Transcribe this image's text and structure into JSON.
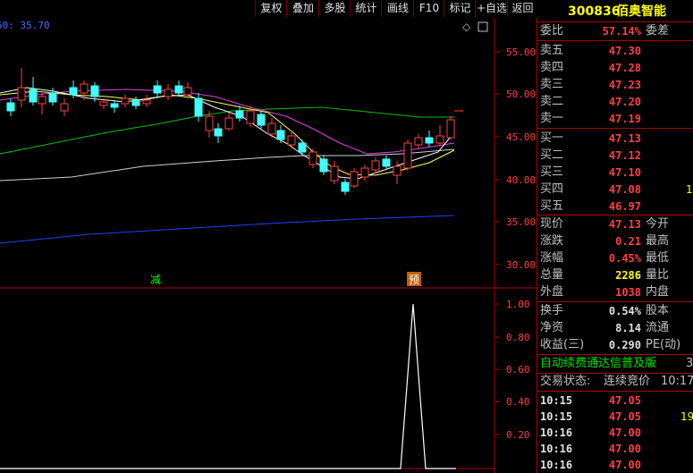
{
  "toolbar": {
    "buttons": [
      "复权",
      "叠加",
      "多股",
      "统计",
      "画线",
      "F10",
      "标记",
      "+自选",
      "返回"
    ]
  },
  "main_chart": {
    "ma_label": "50: 35.70",
    "y_ticks": [
      "55.00",
      "50.00",
      "45.00",
      "40.00",
      "35.00",
      "30.00"
    ],
    "marker_left": "减",
    "marker_right": "预",
    "diamond_icon": "◇"
  },
  "indicator": {
    "y_ticks": [
      "1.00",
      "0.80",
      "0.60",
      "0.40",
      "0.20"
    ]
  },
  "stock": {
    "code": "300836",
    "name": "佰奥智能"
  },
  "ratio": {
    "label": "委比",
    "value": "57.14%",
    "label2": "委差"
  },
  "asks": [
    {
      "label": "卖五",
      "price": "47.30"
    },
    {
      "label": "卖四",
      "price": "47.28"
    },
    {
      "label": "卖三",
      "price": "47.23"
    },
    {
      "label": "卖二",
      "price": "47.20"
    },
    {
      "label": "卖一",
      "price": "47.19"
    }
  ],
  "bids": [
    {
      "label": "买一",
      "price": "47.13"
    },
    {
      "label": "买二",
      "price": "47.12"
    },
    {
      "label": "买三",
      "price": "47.10"
    },
    {
      "label": "买四",
      "price": "47.08",
      "extra": "1"
    },
    {
      "label": "买五",
      "price": "46.97"
    }
  ],
  "quote": [
    {
      "label": "现价",
      "value": "47.13",
      "label2": "今开",
      "color": "red"
    },
    {
      "label": "涨跌",
      "value": "0.21",
      "label2": "最高",
      "color": "red"
    },
    {
      "label": "涨幅",
      "value": "0.45%",
      "label2": "最低",
      "color": "red"
    },
    {
      "label": "总量",
      "value": "2286",
      "label2": "量比",
      "color": "yel"
    },
    {
      "label": "外盘",
      "value": "1038",
      "label2": "内盘",
      "color": "red"
    }
  ],
  "fundamentals": [
    {
      "label": "换手",
      "value": "0.54%",
      "label2": "股本"
    },
    {
      "label": "净资",
      "value": "8.14",
      "label2": "流通"
    },
    {
      "label": "收益(三)",
      "value": "0.290",
      "label2": "PE(动)"
    }
  ],
  "banner": {
    "text": "自动续费通达信普及版",
    "suffix": "3"
  },
  "trade_state": {
    "label": "交易状态:",
    "value": "连续竞价",
    "time": "10:17"
  },
  "ticks": [
    {
      "time": "10:15",
      "price": "47.05",
      "vol": ""
    },
    {
      "time": "10:15",
      "price": "47.05",
      "vol": "19"
    },
    {
      "time": "10:16",
      "price": "47.00",
      "vol": ""
    },
    {
      "time": "10:16",
      "price": "47.00",
      "vol": ""
    },
    {
      "time": "10:16",
      "price": "47.00",
      "vol": ""
    }
  ]
}
